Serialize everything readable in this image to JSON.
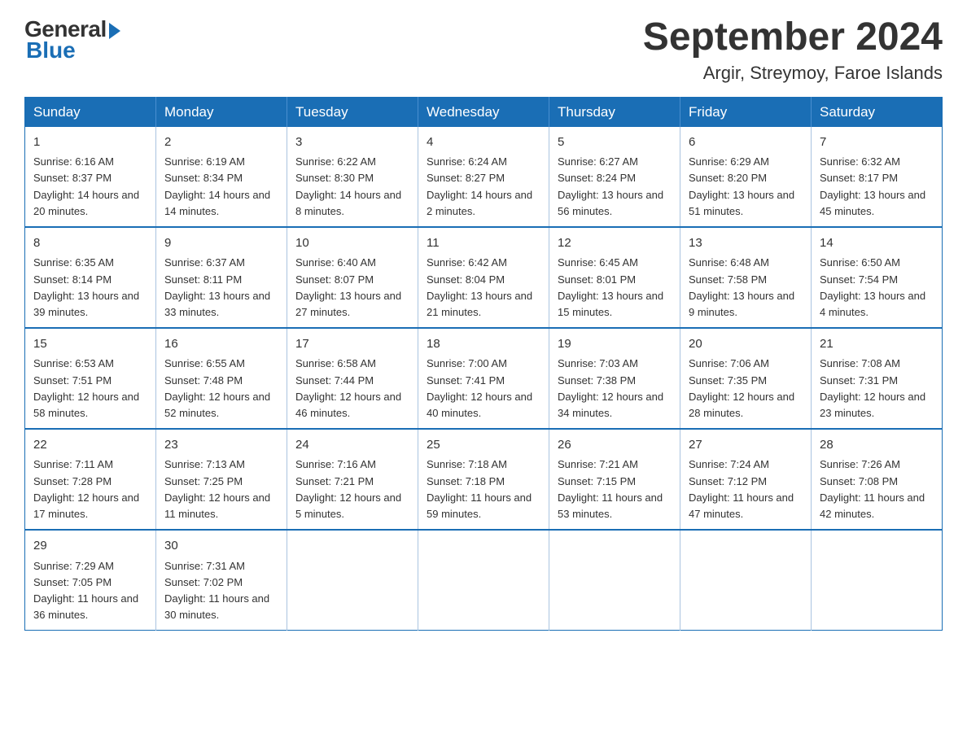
{
  "header": {
    "logo_general": "General",
    "logo_blue": "Blue",
    "month_title": "September 2024",
    "location": "Argir, Streymoy, Faroe Islands"
  },
  "days_of_week": [
    "Sunday",
    "Monday",
    "Tuesday",
    "Wednesday",
    "Thursday",
    "Friday",
    "Saturday"
  ],
  "weeks": [
    [
      {
        "num": "1",
        "sunrise": "6:16 AM",
        "sunset": "8:37 PM",
        "daylight": "14 hours and 20 minutes."
      },
      {
        "num": "2",
        "sunrise": "6:19 AM",
        "sunset": "8:34 PM",
        "daylight": "14 hours and 14 minutes."
      },
      {
        "num": "3",
        "sunrise": "6:22 AM",
        "sunset": "8:30 PM",
        "daylight": "14 hours and 8 minutes."
      },
      {
        "num": "4",
        "sunrise": "6:24 AM",
        "sunset": "8:27 PM",
        "daylight": "14 hours and 2 minutes."
      },
      {
        "num": "5",
        "sunrise": "6:27 AM",
        "sunset": "8:24 PM",
        "daylight": "13 hours and 56 minutes."
      },
      {
        "num": "6",
        "sunrise": "6:29 AM",
        "sunset": "8:20 PM",
        "daylight": "13 hours and 51 minutes."
      },
      {
        "num": "7",
        "sunrise": "6:32 AM",
        "sunset": "8:17 PM",
        "daylight": "13 hours and 45 minutes."
      }
    ],
    [
      {
        "num": "8",
        "sunrise": "6:35 AM",
        "sunset": "8:14 PM",
        "daylight": "13 hours and 39 minutes."
      },
      {
        "num": "9",
        "sunrise": "6:37 AM",
        "sunset": "8:11 PM",
        "daylight": "13 hours and 33 minutes."
      },
      {
        "num": "10",
        "sunrise": "6:40 AM",
        "sunset": "8:07 PM",
        "daylight": "13 hours and 27 minutes."
      },
      {
        "num": "11",
        "sunrise": "6:42 AM",
        "sunset": "8:04 PM",
        "daylight": "13 hours and 21 minutes."
      },
      {
        "num": "12",
        "sunrise": "6:45 AM",
        "sunset": "8:01 PM",
        "daylight": "13 hours and 15 minutes."
      },
      {
        "num": "13",
        "sunrise": "6:48 AM",
        "sunset": "7:58 PM",
        "daylight": "13 hours and 9 minutes."
      },
      {
        "num": "14",
        "sunrise": "6:50 AM",
        "sunset": "7:54 PM",
        "daylight": "13 hours and 4 minutes."
      }
    ],
    [
      {
        "num": "15",
        "sunrise": "6:53 AM",
        "sunset": "7:51 PM",
        "daylight": "12 hours and 58 minutes."
      },
      {
        "num": "16",
        "sunrise": "6:55 AM",
        "sunset": "7:48 PM",
        "daylight": "12 hours and 52 minutes."
      },
      {
        "num": "17",
        "sunrise": "6:58 AM",
        "sunset": "7:44 PM",
        "daylight": "12 hours and 46 minutes."
      },
      {
        "num": "18",
        "sunrise": "7:00 AM",
        "sunset": "7:41 PM",
        "daylight": "12 hours and 40 minutes."
      },
      {
        "num": "19",
        "sunrise": "7:03 AM",
        "sunset": "7:38 PM",
        "daylight": "12 hours and 34 minutes."
      },
      {
        "num": "20",
        "sunrise": "7:06 AM",
        "sunset": "7:35 PM",
        "daylight": "12 hours and 28 minutes."
      },
      {
        "num": "21",
        "sunrise": "7:08 AM",
        "sunset": "7:31 PM",
        "daylight": "12 hours and 23 minutes."
      }
    ],
    [
      {
        "num": "22",
        "sunrise": "7:11 AM",
        "sunset": "7:28 PM",
        "daylight": "12 hours and 17 minutes."
      },
      {
        "num": "23",
        "sunrise": "7:13 AM",
        "sunset": "7:25 PM",
        "daylight": "12 hours and 11 minutes."
      },
      {
        "num": "24",
        "sunrise": "7:16 AM",
        "sunset": "7:21 PM",
        "daylight": "12 hours and 5 minutes."
      },
      {
        "num": "25",
        "sunrise": "7:18 AM",
        "sunset": "7:18 PM",
        "daylight": "11 hours and 59 minutes."
      },
      {
        "num": "26",
        "sunrise": "7:21 AM",
        "sunset": "7:15 PM",
        "daylight": "11 hours and 53 minutes."
      },
      {
        "num": "27",
        "sunrise": "7:24 AM",
        "sunset": "7:12 PM",
        "daylight": "11 hours and 47 minutes."
      },
      {
        "num": "28",
        "sunrise": "7:26 AM",
        "sunset": "7:08 PM",
        "daylight": "11 hours and 42 minutes."
      }
    ],
    [
      {
        "num": "29",
        "sunrise": "7:29 AM",
        "sunset": "7:05 PM",
        "daylight": "11 hours and 36 minutes."
      },
      {
        "num": "30",
        "sunrise": "7:31 AM",
        "sunset": "7:02 PM",
        "daylight": "11 hours and 30 minutes."
      },
      null,
      null,
      null,
      null,
      null
    ]
  ]
}
